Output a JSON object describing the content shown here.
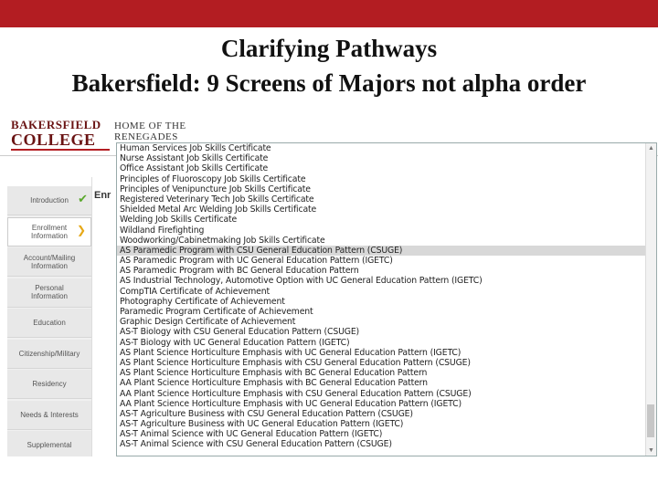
{
  "slide": {
    "title_line1": "Clarifying Pathways",
    "title_line2": "Bakersfield: 9 Screens of Majors not alpha order"
  },
  "colors": {
    "brand_red": "#b31d22",
    "logo_maroon": "#6a1313",
    "check_green": "#5aa82c",
    "arrow_gold": "#e6a817"
  },
  "header": {
    "logo_line1": "BAKERSFIELD",
    "logo_line2": "COLLEGE",
    "tagline_line1": "Home of the",
    "tagline_line2": "Renegades"
  },
  "sidebar": {
    "items": [
      {
        "label": "Introduction",
        "state": "done"
      },
      {
        "label": "Enrollment Information",
        "state": "current"
      },
      {
        "label": "Account/Mailing Information",
        "state": ""
      },
      {
        "label": "Personal Information",
        "state": ""
      },
      {
        "label": "Education",
        "state": ""
      },
      {
        "label": "Citizenship/Military",
        "state": ""
      },
      {
        "label": "Residency",
        "state": ""
      },
      {
        "label": "Needs & Interests",
        "state": ""
      },
      {
        "label": "Supplemental",
        "state": ""
      }
    ]
  },
  "panel": {
    "title": "Enr"
  },
  "dropdown": {
    "highlighted_index": 10,
    "options": [
      "Human Services Job Skills Certificate",
      "Nurse Assistant Job Skills Certificate",
      "Office Assistant Job Skills Certificate",
      "Principles of Fluoroscopy Job Skills Certificate",
      "Principles of Venipuncture Job Skills Certificate",
      "Registered Veterinary Tech Job Skills Certificate",
      "Shielded Metal Arc Welding Job Skills Certificate",
      "Welding Job Skills Certificate",
      "Wildland Firefighting",
      "Woodworking/Cabinetmaking Job Skills Certificate",
      "AS Paramedic Program with CSU General Education Pattern (CSUGE)",
      "AS Paramedic Program with UC General Education Pattern (IGETC)",
      "AS Paramedic Program with BC General Education Pattern",
      "AS Industrial Technology, Automotive Option with UC General Education Pattern (IGETC)",
      "CompTIA Certificate of Achievement",
      "Photography Certificate of Achievement",
      "Paramedic Program Certificate of Achievement",
      "Graphic Design Certificate of Achievement",
      "AS-T Biology with CSU General Education Pattern (CSUGE)",
      "AS-T Biology with UC General Education Pattern (IGETC)",
      "AS Plant Science Horticulture Emphasis with UC General Education Pattern (IGETC)",
      "AS Plant Science Horticulture Emphasis with CSU General Education Pattern (CSUGE)",
      "AS Plant Science Horticulture Emphasis with BC General Education Pattern",
      "AA Plant Science Horticulture Emphasis with BC General Education Pattern",
      "AA Plant Science Horticulture Emphasis with CSU General Education Pattern (CSUGE)",
      "AA Plant Science Horticulture Emphasis with UC General Education Pattern (IGETC)",
      "AS-T Agriculture Business with CSU General Education Pattern (CSUGE)",
      "AS-T Agriculture Business with UC General Education Pattern (IGETC)",
      "AS-T Animal Science with UC General Education Pattern (IGETC)",
      "AS-T Animal Science with CSU General Education Pattern (CSUGE)"
    ]
  }
}
